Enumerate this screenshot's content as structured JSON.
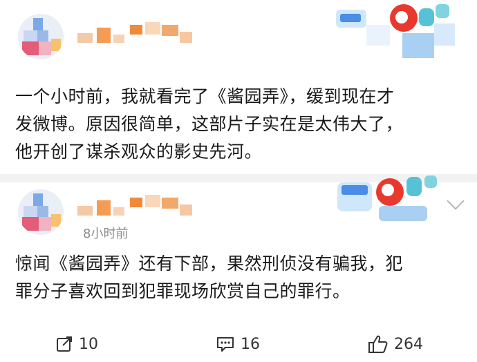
{
  "post1": {
    "content": "一个小时前，我就看完了《酱园弄》，缓到现在才\n发微博。原因很简单，这部片子实在是太伟大了，\n他开创了谋杀观众的影史先河。"
  },
  "post2": {
    "time": "8小时前",
    "content": "惊闻《酱园弄》还有下部，果然刑侦没有骗我，犯\n罪分子喜欢回到犯罪现场欣赏自己的罪行。"
  },
  "actions": {
    "repost_count": "10",
    "comment_count": "16",
    "like_count": "264"
  },
  "icons": {
    "repost": "share-icon",
    "comment": "comment-icon",
    "like": "thumbs-up-icon",
    "more": "chevron-down-icon"
  },
  "colors": {
    "text": "#1a1a1a",
    "meta": "#8a8a8a",
    "divider": "#f2f2f2"
  }
}
